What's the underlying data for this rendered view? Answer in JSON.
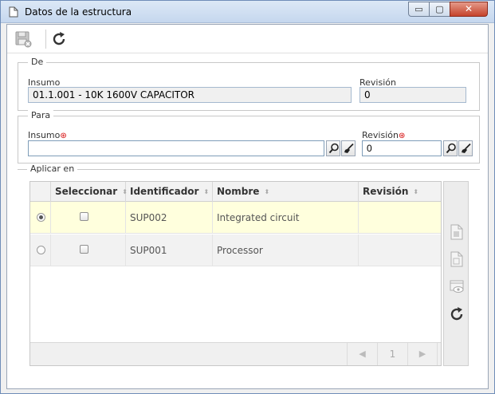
{
  "window": {
    "title": "Datos de la estructura",
    "min_glyph": "▭",
    "max_glyph": "▢",
    "close_glyph": "✕"
  },
  "toolbar": {
    "save_icon": "save-disabled-icon",
    "refresh_icon": "refresh-icon"
  },
  "de": {
    "legend": "De",
    "insumo_label": "Insumo",
    "insumo_value": "01.1.001 - 10K 1600V CAPACITOR",
    "revision_label": "Revisión",
    "revision_value": "0"
  },
  "para": {
    "legend": "Para",
    "insumo_label": "Insumo",
    "insumo_value": "",
    "revision_label": "Revisión",
    "revision_value": "0",
    "required_mark": "⊛"
  },
  "aplicar": {
    "legend": "Aplicar en",
    "columns": [
      "Seleccionar",
      "Identificador",
      "Nombre",
      "Revisión"
    ],
    "sort_glyph": "⬍",
    "rows": [
      {
        "id": "SUP002",
        "name": "Integrated circuit",
        "revision": "",
        "active": true
      },
      {
        "id": "SUP001",
        "name": "Processor",
        "revision": "",
        "active": false
      }
    ],
    "pagination": {
      "prev": "◀",
      "page": "1",
      "next": "▶"
    },
    "accent": "#ffffdd"
  }
}
